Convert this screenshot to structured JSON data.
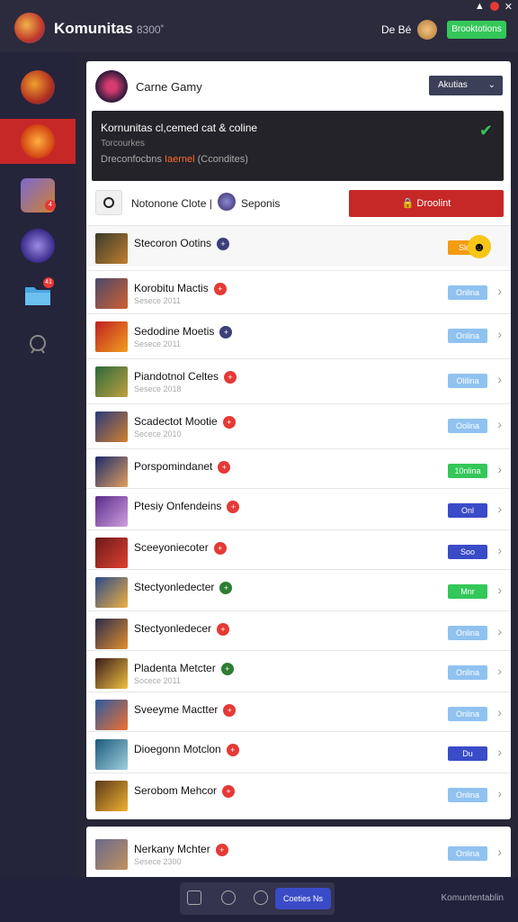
{
  "topbar": {
    "title": "Komunitas",
    "title_sub": "8300˚",
    "user_label": "De Bé",
    "button_label": "Brooktotions",
    "status_icons": [
      "wifi-icon",
      "record-icon",
      "close-icon"
    ]
  },
  "sidebar": {
    "items": [
      {
        "icon": "game-avatar-1"
      },
      {
        "icon": "game-avatar-2",
        "active": true
      },
      {
        "icon": "game-avatar-3",
        "badge": "4"
      },
      {
        "icon": "game-avatar-4"
      },
      {
        "icon": "folder-icon",
        "badge": "41"
      },
      {
        "icon": "user-icon"
      }
    ],
    "bottom_icon": "pin-icon"
  },
  "panel": {
    "title": "Carne Gamy",
    "filter_label": "Akutias",
    "banner": {
      "title": "Kornunitas cl,cemed cat & coline",
      "subtitle": "Torcourkes",
      "line_prefix": "Dreconfocbns ",
      "line_highlight": "Iaernel",
      "line_suffix": " (Ccondites)"
    },
    "segment_label": "Notonone Clote |",
    "segment_label2": "Seponis",
    "action_button": "Droolint"
  },
  "rows": [
    {
      "name": "Stecoron Ootins",
      "sub": "",
      "badge_color": "#3b3f7a",
      "pill": "Slooi",
      "pill_color": "#f39c12",
      "emoji": true
    },
    {
      "name": "Korobitu Mactis",
      "sub": "Sesece 2011",
      "badge_color": "#e53935",
      "pill": "Onlina",
      "pill_color": "#90c2f0"
    },
    {
      "name": "Sedodine Moetis",
      "sub": "Sesece 2011",
      "badge_color": "#3b3f7a",
      "pill": "Onlina",
      "pill_color": "#90c2f0"
    },
    {
      "name": "Piandotnol Celtes",
      "sub": "Sesece 2018",
      "badge_color": "#e53935",
      "pill": "Olilina",
      "pill_color": "#90c2f0"
    },
    {
      "name": "Scadectot Mootie",
      "sub": "Secece 2010",
      "badge_color": "#e53935",
      "pill": "Oolina",
      "pill_color": "#90c2f0"
    },
    {
      "name": "Porspomindanet",
      "sub": "",
      "badge_color": "#e53935",
      "pill": "10nlina",
      "pill_color": "#34c759"
    },
    {
      "name": "Ptesiy Onfendeins",
      "sub": "",
      "badge_color": "#e53935",
      "pill": "Onl",
      "pill_color": "#3a4bc8"
    },
    {
      "name": "Sceeyoniecoter",
      "sub": "",
      "badge_color": "#e53935",
      "pill": "Soo",
      "pill_color": "#3a4bc8"
    },
    {
      "name": "Stectyonledecter",
      "sub": "",
      "badge_color": "#2e7d32",
      "pill": "Mnr",
      "pill_color": "#34c759"
    },
    {
      "name": "Stectyonledecer",
      "sub": "",
      "badge_color": "#e53935",
      "pill": "Onlina",
      "pill_color": "#90c2f0"
    },
    {
      "name": "Pladenta Metcter",
      "sub": "Socece 2011",
      "badge_color": "#2e7d32",
      "pill": "Onlina",
      "pill_color": "#90c2f0"
    },
    {
      "name": "Sveeyme Mactter",
      "sub": "",
      "badge_color": "#e53935",
      "pill": "Onlina",
      "pill_color": "#90c2f0"
    },
    {
      "name": "Dioegonn Motclon",
      "sub": "",
      "badge_color": "#e53935",
      "pill": "Du",
      "pill_color": "#3a4bc8"
    },
    {
      "name": "Serobom Mehcor",
      "sub": "",
      "badge_color": "#e53935",
      "pill": "Onlina",
      "pill_color": "#90c2f0"
    }
  ],
  "panel2_row": {
    "name": "Nerkany Mchter",
    "sub": "Sesece 2300",
    "badge_color": "#e53935",
    "pill": "Onlina",
    "pill_color": "#90c2f0"
  },
  "bottombar": {
    "button_label": "Coeties Ns",
    "right_label": "Komuntentablin"
  }
}
